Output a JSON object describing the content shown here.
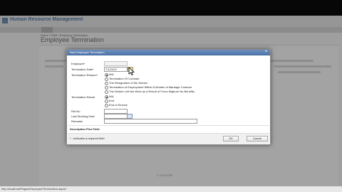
{
  "app": {
    "title": "Human Resource Management",
    "user_info": "",
    "user_links": ""
  },
  "nav": {
    "items": [
      "",
      "",
      "",
      "",
      "",
      "",
      ""
    ]
  },
  "page": {
    "breadcrumb": "Home › HRM › Employee Termination",
    "title": "Employee Termination"
  },
  "dialog": {
    "title": "New Employee Termination",
    "fields": {
      "employee_label": "Employee*",
      "employee_value": "",
      "termination_date_label": "Termination Date*",
      "termination_date_value": "7/1/2019",
      "termination_reason_label": "Termination Reason*",
      "termination_result_label": "Termination Result",
      "ref_no_label": "Ref No",
      "last_working_date_label": "Last Working Date",
      "remarks_label": "Remarks"
    },
    "reasons": [
      "N/A",
      "Termination Of Contract",
      "The Resignation of the Worker",
      "Termination of Employment Within 6 Months of Marriage Contract",
      "The Worker Left the Work as a Result of Force Majeure No Benefits"
    ],
    "results": [
      "N/A",
      "End",
      "End of Service"
    ],
    "section_label": "Description Flex Field",
    "required_note": "* - indicates a required field",
    "ok_label": "OK",
    "cancel_label": "Cancel"
  },
  "footer": {
    "copyright": "© 2019 ERP"
  },
  "status": {
    "url": "http://localhost/Pages/Employee/Termination.aspx#"
  }
}
